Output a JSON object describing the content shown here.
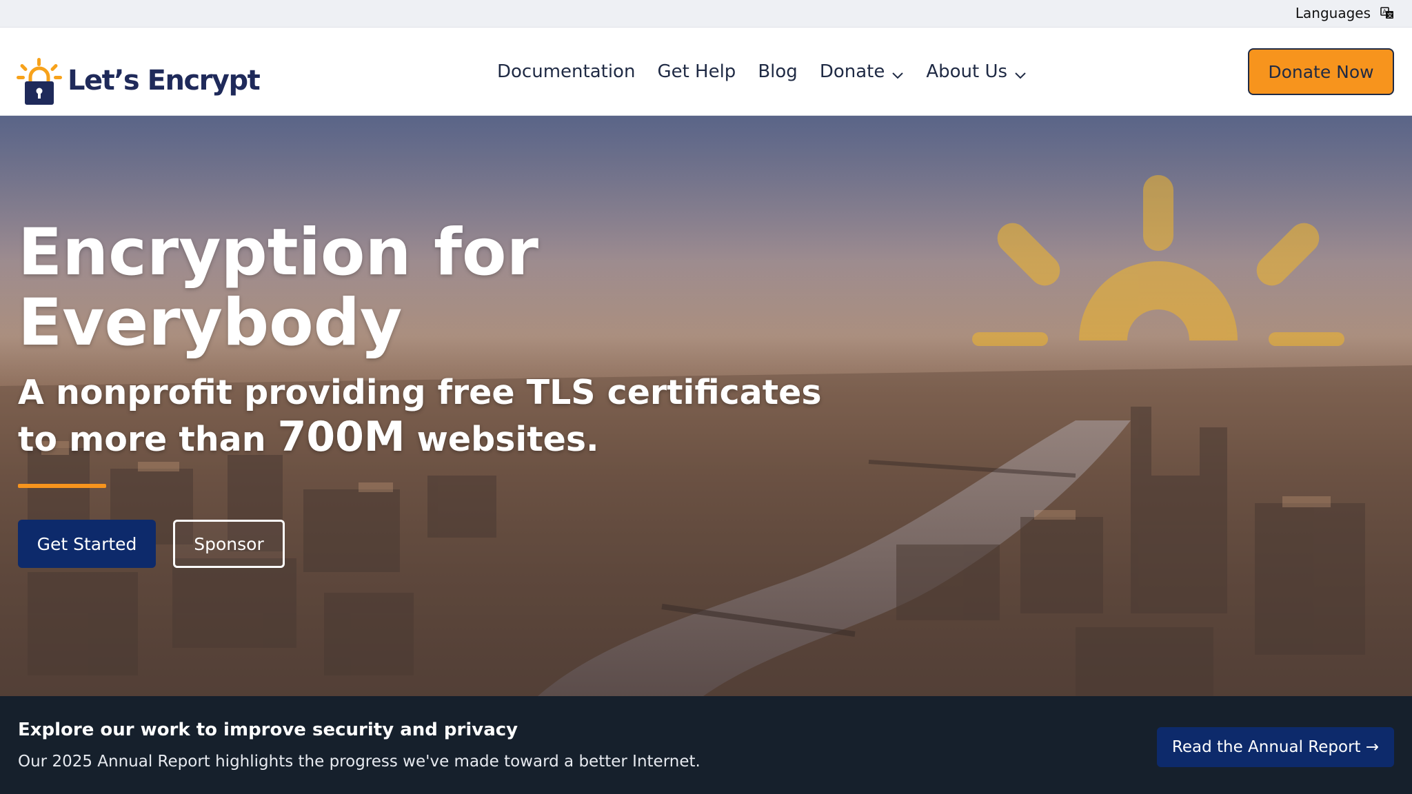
{
  "topbar": {
    "languages_label": "Languages",
    "languages_icon": "translate-icon"
  },
  "header": {
    "logo_text": "Let’s Encrypt",
    "logo_icon": "padlock-sun-icon",
    "nav": [
      {
        "label": "Documentation",
        "has_dropdown": false
      },
      {
        "label": "Get Help",
        "has_dropdown": false
      },
      {
        "label": "Blog",
        "has_dropdown": false
      },
      {
        "label": "Donate",
        "has_dropdown": true
      },
      {
        "label": "About Us",
        "has_dropdown": true
      }
    ],
    "donate_button_label": "Donate Now"
  },
  "hero": {
    "title_line1": "Encryption for",
    "title_line2": "Everybody",
    "subtitle_part1": "A nonprofit providing free TLS certificates",
    "subtitle_part2": "to more than ",
    "subtitle_highlight": "700M",
    "subtitle_part3": " websites.",
    "primary_button_label": "Get Started",
    "secondary_button_label": "Sponsor"
  },
  "banner": {
    "title": "Explore our work to improve security and privacy",
    "text": "Our 2025 Annual Report highlights the progress we've made toward a better Internet.",
    "button_label": "Read the Annual Report →"
  },
  "colors": {
    "accent_orange": "#f7941d",
    "navy": "#0d2a6b",
    "banner_bg": "#16202c",
    "logo_navy": "#1f2a5a"
  }
}
